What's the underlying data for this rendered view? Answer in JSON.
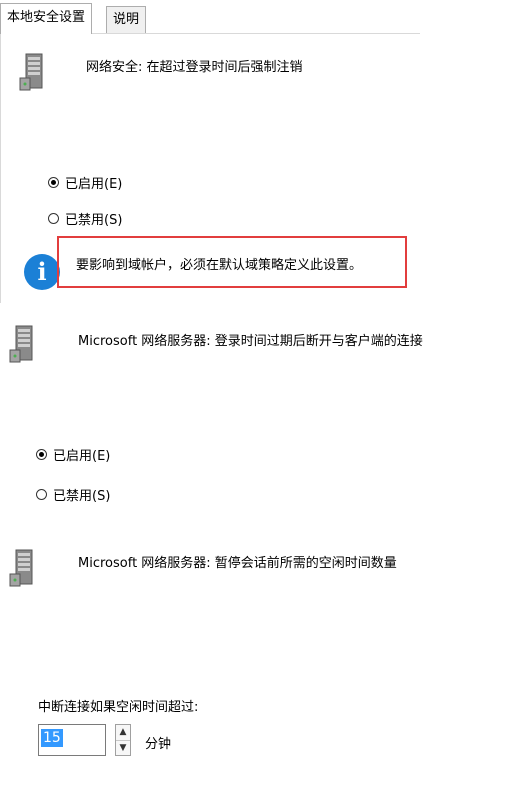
{
  "tabs": [
    {
      "label": "本地安全设置",
      "active": true
    },
    {
      "label": "说明",
      "active": false
    }
  ],
  "section1": {
    "icon": "server-icon",
    "title": "网络安全: 在超过登录时间后强制注销",
    "options": [
      {
        "label": "已启用(E)",
        "selected": true
      },
      {
        "label": "已禁用(S)",
        "selected": false
      }
    ],
    "info": {
      "icon": "info-icon",
      "text": "要影响到域帐户，必须在默认域策略定义此设置。",
      "highlight_color": "#e23d3d"
    }
  },
  "section2": {
    "icon": "server-icon",
    "title": "Microsoft 网络服务器: 登录时间过期后断开与客户端的连接",
    "options": [
      {
        "label": "已启用(E)",
        "selected": true
      },
      {
        "label": "已禁用(S)",
        "selected": false
      }
    ]
  },
  "section3": {
    "icon": "server-icon",
    "title": "Microsoft 网络服务器: 暂停会话前所需的空闲时间数量",
    "field_label": "中断连接如果空闲时间超过:",
    "value": "15",
    "unit": "分钟"
  },
  "colors": {
    "accent": "#3399ff",
    "info": "#1b80d6",
    "border": "#adadad"
  }
}
